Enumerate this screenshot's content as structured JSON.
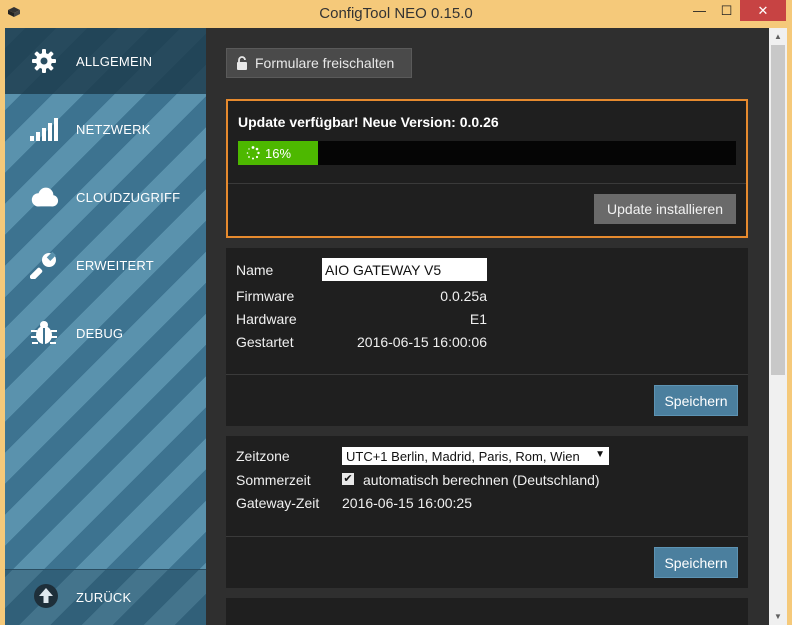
{
  "window": {
    "title": "ConfigTool NEO 0.15.0",
    "min_glyph": "—",
    "max_glyph": "☐",
    "close_glyph": "✕"
  },
  "sidebar": {
    "items": [
      {
        "label": "ALLGEMEIN",
        "icon": "gear-icon",
        "active": true
      },
      {
        "label": "NETZWERK",
        "icon": "signal-bars-icon",
        "active": false
      },
      {
        "label": "CLOUDZUGRIFF",
        "icon": "cloud-icon",
        "active": false
      },
      {
        "label": "ERWEITERT",
        "icon": "wrench-icon",
        "active": false
      },
      {
        "label": "DEBUG",
        "icon": "bug-icon",
        "active": false
      }
    ],
    "back_label": "ZURÜCK",
    "back_icon": "arrow-up-circle-icon"
  },
  "main": {
    "unlock_label": "Formulare freischalten",
    "update": {
      "title": "Update verfügbar! Neue Version: 0.0.26",
      "progress_percent": 16,
      "progress_label": "16%",
      "install_label": "Update installieren"
    },
    "info": {
      "name_label": "Name",
      "name_value": "AIO GATEWAY V5",
      "firmware_label": "Firmware",
      "firmware_value": "0.0.25a",
      "hardware_label": "Hardware",
      "hardware_value": "E1",
      "started_label": "Gestartet",
      "started_value": "2016-06-15 16:00:06",
      "save_label": "Speichern"
    },
    "time": {
      "timezone_label": "Zeitzone",
      "timezone_value": "UTC+1  Berlin, Madrid, Paris, Rom, Wien",
      "dst_label": "Sommerzeit",
      "dst_checked": true,
      "dst_option_label": "automatisch berechnen (Deutschland)",
      "gateway_time_label": "Gateway-Zeit",
      "gateway_time_value": "2016-06-15 16:00:25",
      "save_label": "Speichern"
    }
  },
  "colors": {
    "sidebar_blue": "#3d7390",
    "accent_orange": "#e68a2e",
    "progress_green": "#4db800",
    "save_blue": "#4b7f9e"
  }
}
